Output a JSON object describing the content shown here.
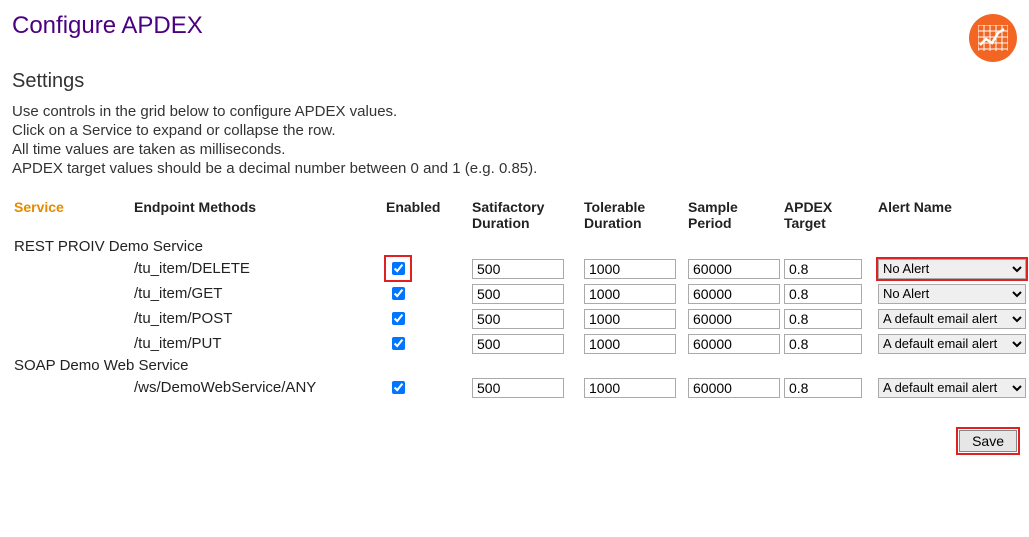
{
  "page": {
    "title": "Configure APDEX",
    "section": "Settings",
    "intro": [
      "Use controls in the grid below to configure APDEX values.",
      "Click on a Service to expand or collapse the row.",
      "All time values are taken as milliseconds.",
      "APDEX target values should be a decimal number between 0 and 1 (e.g. 0.85)."
    ]
  },
  "columns": {
    "service": "Service",
    "endpoint": "Endpoint Methods",
    "enabled": "Enabled",
    "satisfactory": "Satifactory Duration",
    "tolerable": "Tolerable Duration",
    "sample": "Sample Period",
    "apdex": "APDEX Target",
    "alert": "Alert Name"
  },
  "alert_options": {
    "none": "No Alert",
    "default_email": "A default email alert"
  },
  "services": [
    {
      "name": "REST PROIV Demo Service",
      "rows": [
        {
          "endpoint": "/tu_item/DELETE",
          "enabled": true,
          "sat": "500",
          "tol": "1000",
          "sample": "60000",
          "apdex": "0.8",
          "alert": "none",
          "highlight_cb": true,
          "highlight_select": true
        },
        {
          "endpoint": "/tu_item/GET",
          "enabled": true,
          "sat": "500",
          "tol": "1000",
          "sample": "60000",
          "apdex": "0.8",
          "alert": "none",
          "highlight_cb": false,
          "highlight_select": false
        },
        {
          "endpoint": "/tu_item/POST",
          "enabled": true,
          "sat": "500",
          "tol": "1000",
          "sample": "60000",
          "apdex": "0.8",
          "alert": "default_email",
          "highlight_cb": false,
          "highlight_select": false
        },
        {
          "endpoint": "/tu_item/PUT",
          "enabled": true,
          "sat": "500",
          "tol": "1000",
          "sample": "60000",
          "apdex": "0.8",
          "alert": "default_email",
          "highlight_cb": false,
          "highlight_select": false
        }
      ]
    },
    {
      "name": "SOAP Demo Web Service",
      "rows": [
        {
          "endpoint": "/ws/DemoWebService/ANY",
          "enabled": true,
          "sat": "500",
          "tol": "1000",
          "sample": "60000",
          "apdex": "0.8",
          "alert": "default_email",
          "highlight_cb": false,
          "highlight_select": false
        }
      ]
    }
  ],
  "footer": {
    "save_label": "Save"
  }
}
